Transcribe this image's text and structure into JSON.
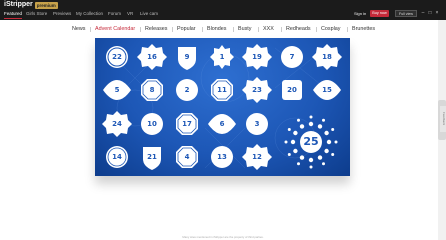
{
  "header": {
    "brand": "iStripper",
    "badge": "premium",
    "nav": [
      {
        "label": "Featured",
        "active": true
      },
      {
        "label": "Girls Store",
        "active": false
      },
      {
        "label": "Previews",
        "active": false
      },
      {
        "label": "My Collection",
        "active": false
      },
      {
        "label": "Forum",
        "active": false
      },
      {
        "label": "VR",
        "active": false
      },
      {
        "label": "Live cam",
        "active": false
      }
    ],
    "signin": "Sign in",
    "buy_now": "Buy now",
    "view_mode": "Full view",
    "window_controls": [
      "minimize-icon",
      "maximize-icon",
      "close-icon"
    ]
  },
  "categories": [
    {
      "label": "News",
      "active": false
    },
    {
      "label": "Advent Calendar",
      "active": true
    },
    {
      "label": "Releases",
      "active": false
    },
    {
      "label": "Popular",
      "active": false
    },
    {
      "label": "Blondes",
      "active": false
    },
    {
      "label": "Busty",
      "active": false
    },
    {
      "label": "XXX",
      "active": false
    },
    {
      "label": "Redheads",
      "active": false
    },
    {
      "label": "Cosplay",
      "active": false
    },
    {
      "label": "Brunettes",
      "active": false
    }
  ],
  "calendar": {
    "days": [
      {
        "day": "22",
        "shape": "circle"
      },
      {
        "day": "16",
        "shape": "badge"
      },
      {
        "day": "9",
        "shape": "shield"
      },
      {
        "day": "1",
        "shape": "gear"
      },
      {
        "day": "19",
        "shape": "badge"
      },
      {
        "day": "7",
        "shape": "circle"
      },
      {
        "day": "18",
        "shape": "badge"
      },
      {
        "day": "5",
        "shape": "lemon"
      },
      {
        "day": "8",
        "shape": "octagon"
      },
      {
        "day": "2",
        "shape": "circle"
      },
      {
        "day": "11",
        "shape": "octagon"
      },
      {
        "day": "23",
        "shape": "badge"
      },
      {
        "day": "20",
        "shape": "square"
      },
      {
        "day": "15",
        "shape": "lemon"
      },
      {
        "day": "24",
        "shape": "badge"
      },
      {
        "day": "10",
        "shape": "circle"
      },
      {
        "day": "17",
        "shape": "octagon"
      },
      {
        "day": "6",
        "shape": "lemon"
      },
      {
        "day": "3",
        "shape": "circle"
      },
      {
        "day": "14",
        "shape": "circle"
      },
      {
        "day": "21",
        "shape": "shield"
      },
      {
        "day": "4",
        "shape": "octagon"
      },
      {
        "day": "13",
        "shape": "circle"
      },
      {
        "day": "12",
        "shape": "badge"
      }
    ],
    "big_day": "25",
    "big_shape": "dot-ring"
  },
  "side_tab": "Feedback",
  "footer": "Many sites mentioned in iStripper are the property of third parties."
}
